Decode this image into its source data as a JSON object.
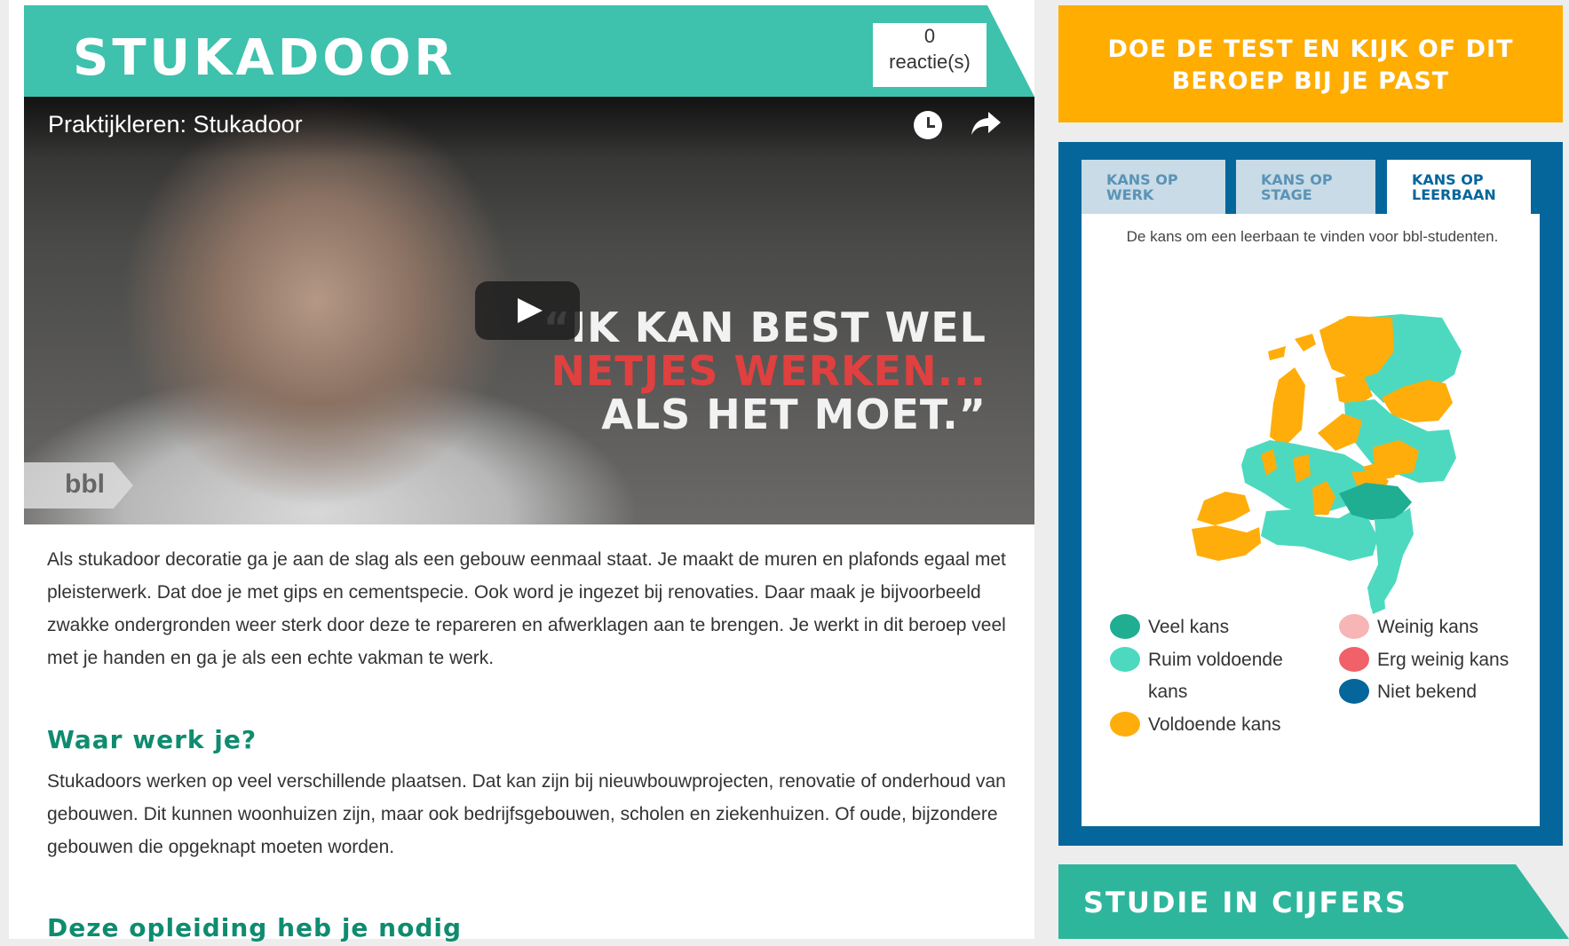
{
  "header": {
    "title": "STUKADOOR",
    "comment_count": "0",
    "comment_label": "reactie(s)"
  },
  "video": {
    "title": "Praktijkleren: Stukadoor",
    "quote_line1": "“IK KAN BEST WEL",
    "quote_line2": "NETJES WERKEN...",
    "quote_line3": "ALS HET MOET.”",
    "badge": "bbl",
    "icons": [
      "clock-icon",
      "share-icon",
      "play-icon"
    ]
  },
  "content": {
    "intro": "Als stukadoor decoratie ga je aan de slag als een gebouw eenmaal staat. Je maakt de muren en plafonds egaal met pleisterwerk. Dat doe je met gips en cementspecie. Ook word je ingezet bij renovaties. Daar maak je bijvoorbeeld zwakke ondergronden weer sterk door deze te repareren en afwerklagen aan te brengen. Je werkt in dit beroep veel met je handen en ga je als een echte vakman te werk.",
    "heading_where": "Waar werk je?",
    "where_text": "Stukadoors werken op veel verschillende plaatsen. Dat kan zijn bij nieuwbouwprojecten, renovatie of onderhoud van gebouwen. Dit kunnen woonhuizen zijn, maar ook bedrijfsgebouwen, scholen en ziekenhuizen. Of oude, bijzondere gebouwen die opgeknapt moeten worden.",
    "heading_education": "Deze opleiding heb je nodig"
  },
  "sidebar": {
    "cta": "DOE DE TEST EN KIJK OF DIT BEROEP BIJ JE PAST",
    "tabs": [
      {
        "label": "KANS OP WERK",
        "active": false
      },
      {
        "label": "KANS OP STAGE",
        "active": false
      },
      {
        "label": "KANS OP LEERBAAN",
        "active": true
      }
    ],
    "map_description": "De kans om een leerbaan te vinden voor bbl-studenten.",
    "legend": [
      {
        "label": "Veel kans",
        "color": "#1fae92"
      },
      {
        "label": "Weinig kans",
        "color": "#f7b5b5"
      },
      {
        "label": "Ruim voldoende kans",
        "color": "#4dd9bf"
      },
      {
        "label": "Erg weinig kans",
        "color": "#f0616a"
      },
      {
        "label": "Voldoende kans",
        "color": "#ffad0a"
      },
      {
        "label": "Niet bekend",
        "color": "#05669b"
      }
    ],
    "studie_heading": "STUDIE IN CIJFERS"
  },
  "colors": {
    "teal": "#3ec1ad",
    "orange": "#ffad00",
    "navy": "#05669b",
    "heading_green": "#0f8c6f"
  }
}
